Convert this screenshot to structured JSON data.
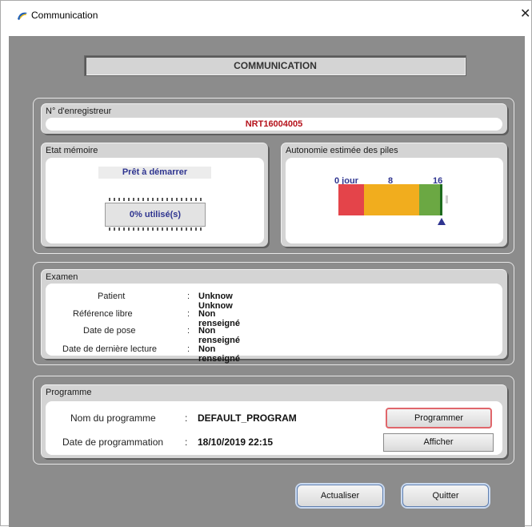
{
  "window": {
    "title": "Communication",
    "close_glyph": "✕"
  },
  "header": {
    "title": "COMMUNICATION"
  },
  "recorder": {
    "label": "N° d'enregistreur",
    "value": "NRT16004005"
  },
  "memory": {
    "label": "Etat mémoire",
    "status": "Prêt à démarrer",
    "usage": "0% utilisé(s)",
    "usage_fraction": 0
  },
  "battery": {
    "label": "Autonomie estimée des piles",
    "ticks": [
      "0 jour",
      "8",
      "16"
    ],
    "segment_colors": [
      "#e4444a",
      "#f1ad1e",
      "#6ba843",
      "#1d6b1d"
    ],
    "estimate_days": 16
  },
  "exam": {
    "label": "Examen",
    "rows": [
      {
        "label": "Patient",
        "value": "Unknow Unknow"
      },
      {
        "label": "Référence libre",
        "value": "Non renseigné"
      },
      {
        "label": "Date de pose",
        "value": "Non renseigné"
      },
      {
        "label": "Date de dernière lecture",
        "value": "Non renseigné"
      }
    ]
  },
  "program": {
    "label": "Programme",
    "name_label": "Nom du programme",
    "name_value": "DEFAULT_PROGRAM",
    "date_label": "Date de programmation",
    "date_value": "18/10/2019 22:15",
    "program_button": "Programmer",
    "show_button": "Afficher"
  },
  "footer": {
    "refresh_button": "Actualiser",
    "quit_button": "Quitter"
  },
  "colors": {
    "accent_text": "#2f3590",
    "record_text": "#b5121b",
    "program_button_border": "#e0666b"
  }
}
